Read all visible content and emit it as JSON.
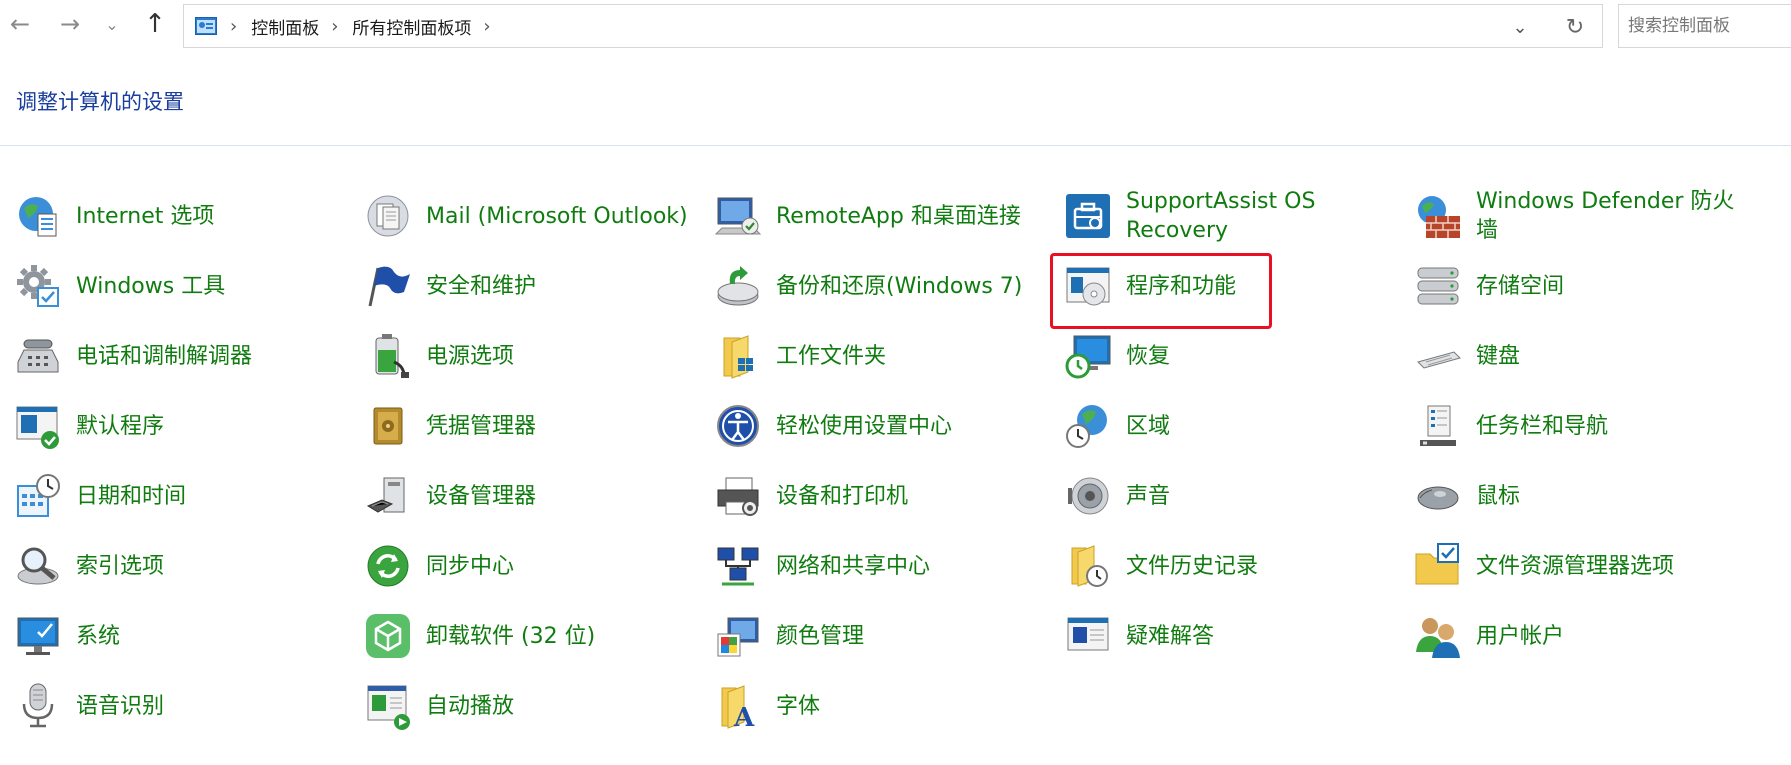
{
  "address_bar": {
    "breadcrumb": [
      "控制面板",
      "所有控制面板项"
    ],
    "search_placeholder": "搜索控制面板"
  },
  "heading": "调整计算机的设置",
  "highlight_color": "#e81123",
  "link_color": "#107c10",
  "heading_color": "#1a3e9e",
  "items": [
    {
      "label": "Internet 选项",
      "icon": "globe-icon"
    },
    {
      "label": "Mail (Microsoft Outlook)",
      "icon": "mail-icon"
    },
    {
      "label": "RemoteApp 和桌面连接",
      "icon": "remote-desktop-icon"
    },
    {
      "label": "SupportAssist OS Recovery",
      "icon": "toolbox-icon"
    },
    {
      "label": "Windows Defender 防火墙",
      "icon": "firewall-icon"
    },
    {
      "label": "Windows 工具",
      "icon": "tools-gear-icon"
    },
    {
      "label": "安全和维护",
      "icon": "flag-icon"
    },
    {
      "label": "备份和还原(Windows 7)",
      "icon": "backup-icon"
    },
    {
      "label": "程序和功能",
      "icon": "programs-icon"
    },
    {
      "label": "存储空间",
      "icon": "storage-icon"
    },
    {
      "label": "电话和调制解调器",
      "icon": "phone-icon"
    },
    {
      "label": "电源选项",
      "icon": "battery-icon"
    },
    {
      "label": "工作文件夹",
      "icon": "work-folder-icon"
    },
    {
      "label": "恢复",
      "icon": "recovery-icon"
    },
    {
      "label": "键盘",
      "icon": "keyboard-icon"
    },
    {
      "label": "默认程序",
      "icon": "default-programs-icon"
    },
    {
      "label": "凭据管理器",
      "icon": "vault-icon"
    },
    {
      "label": "轻松使用设置中心",
      "icon": "ease-of-access-icon"
    },
    {
      "label": "区域",
      "icon": "region-icon"
    },
    {
      "label": "任务栏和导航",
      "icon": "taskbar-icon"
    },
    {
      "label": "日期和时间",
      "icon": "calendar-clock-icon"
    },
    {
      "label": "设备管理器",
      "icon": "device-manager-icon"
    },
    {
      "label": "设备和打印机",
      "icon": "printer-icon"
    },
    {
      "label": "声音",
      "icon": "speaker-icon"
    },
    {
      "label": "鼠标",
      "icon": "mouse-icon"
    },
    {
      "label": "索引选项",
      "icon": "index-icon"
    },
    {
      "label": "同步中心",
      "icon": "sync-icon"
    },
    {
      "label": "网络和共享中心",
      "icon": "network-icon"
    },
    {
      "label": "文件历史记录",
      "icon": "file-history-icon"
    },
    {
      "label": "文件资源管理器选项",
      "icon": "folder-options-icon"
    },
    {
      "label": "系统",
      "icon": "system-icon"
    },
    {
      "label": "卸载软件 (32 位)",
      "icon": "uninstall-icon"
    },
    {
      "label": "颜色管理",
      "icon": "color-management-icon"
    },
    {
      "label": "疑难解答",
      "icon": "troubleshoot-icon"
    },
    {
      "label": "用户帐户",
      "icon": "users-icon"
    },
    {
      "label": "语音识别",
      "icon": "microphone-icon"
    },
    {
      "label": "自动播放",
      "icon": "autoplay-icon"
    },
    {
      "label": "字体",
      "icon": "font-icon"
    }
  ]
}
